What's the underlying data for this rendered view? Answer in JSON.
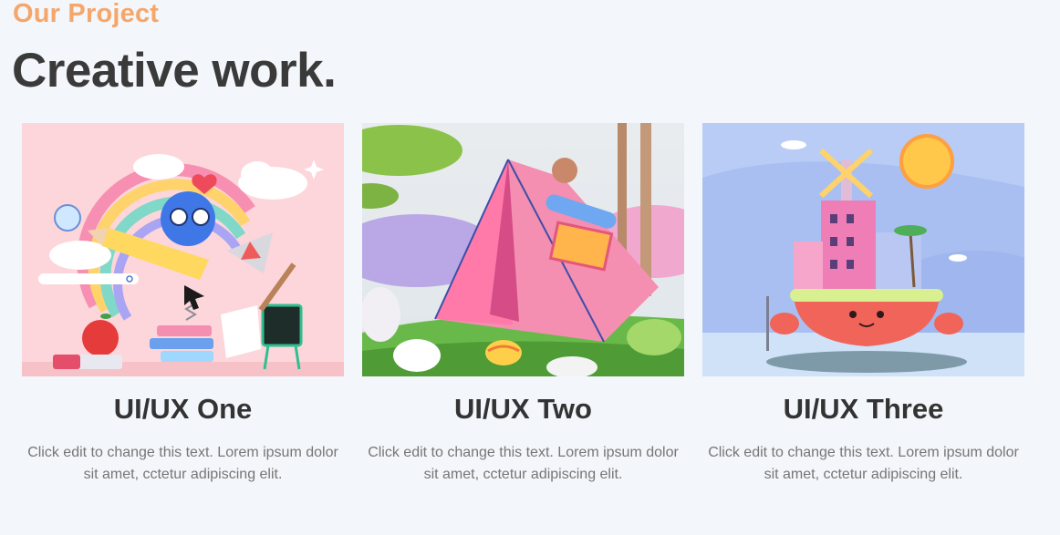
{
  "section": {
    "eyebrow": "Our Project",
    "headline": "Creative work."
  },
  "projects": [
    {
      "title": "UI/UX One",
      "description": "Click edit to change this text. Lorem ipsum dolor sit amet, cctetur adipiscing elit.",
      "image": "pink-rainbow-illustration"
    },
    {
      "title": "UI/UX Two",
      "description": "Click edit to change this text. Lorem ipsum dolor sit amet, cctetur adipiscing elit.",
      "image": "pink-tent-illustration"
    },
    {
      "title": "UI/UX Three",
      "description": "Click edit to change this text. Lorem ipsum dolor sit amet, cctetur adipiscing elit.",
      "image": "crab-island-illustration"
    }
  ],
  "colors": {
    "accent": "#f5a66b",
    "heading": "#3a3a3a",
    "body_text": "#767676",
    "background": "#f3f6fa"
  }
}
